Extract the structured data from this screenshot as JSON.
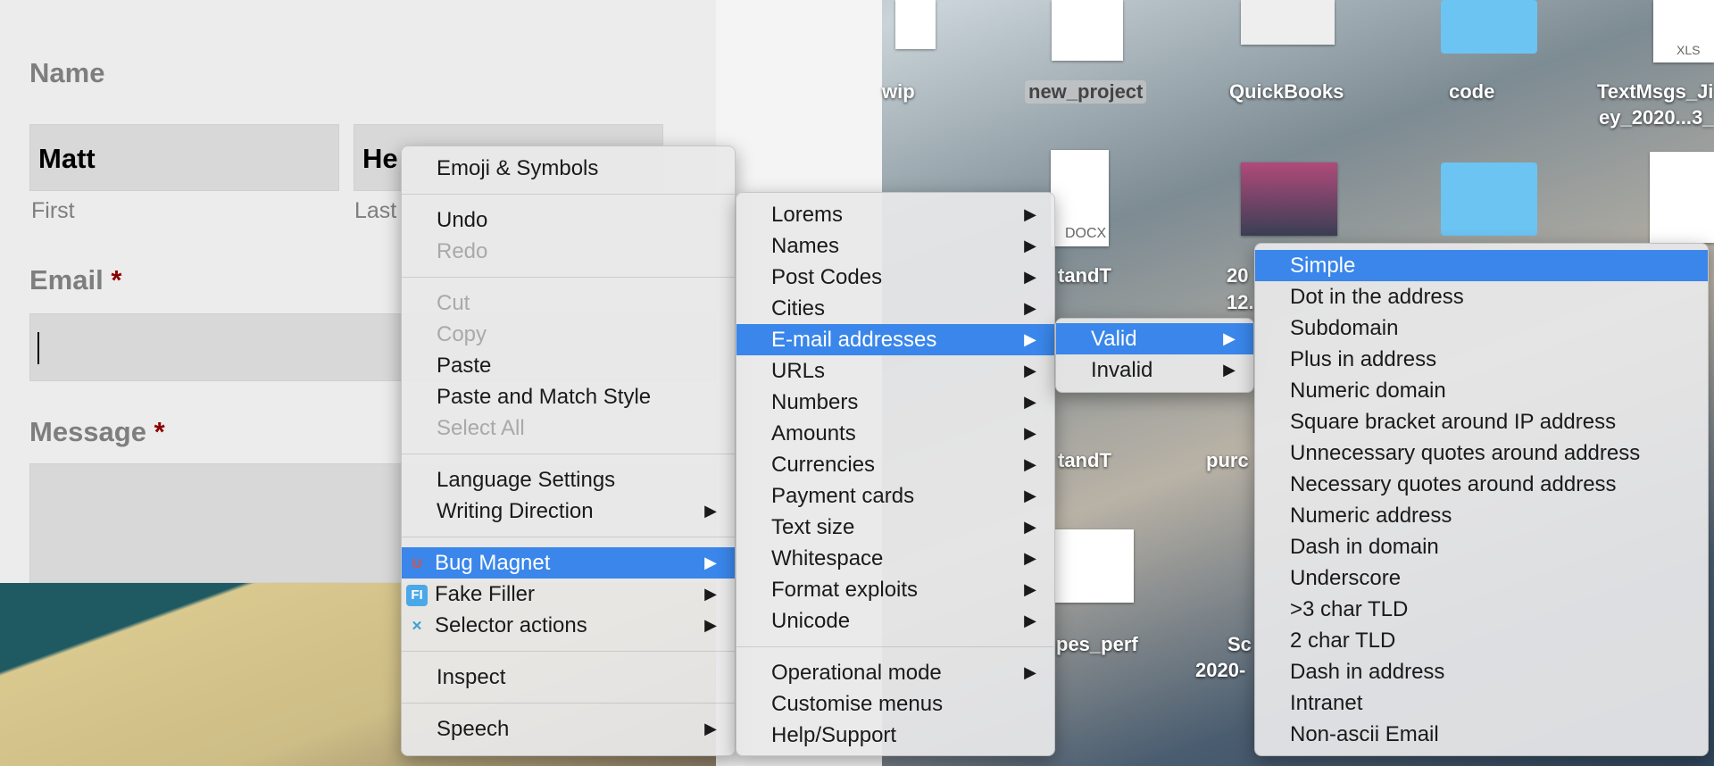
{
  "form": {
    "name_label": "Name",
    "first_value": "Matt",
    "last_value": "He",
    "first_sub": "First",
    "last_sub": "Last",
    "email_label": "Email",
    "message_label": "Message",
    "required_mark": "*"
  },
  "desktop": {
    "labels": [
      "wip",
      "new_project",
      "QuickBooks",
      "code",
      "TextMsgs_Ji",
      "ey_2020...3_",
      "tandT",
      "20",
      "12.",
      "tandT",
      "purc",
      "pes_perf",
      "Sc",
      "2020-",
      "DOCX",
      "XLS"
    ]
  },
  "context_menu": {
    "groups": [
      [
        {
          "label": "Emoji & Symbols"
        }
      ],
      [
        {
          "label": "Undo"
        },
        {
          "label": "Redo",
          "disabled": true
        }
      ],
      [
        {
          "label": "Cut",
          "disabled": true
        },
        {
          "label": "Copy",
          "disabled": true
        },
        {
          "label": "Paste"
        },
        {
          "label": "Paste and Match Style"
        },
        {
          "label": "Select All",
          "disabled": true
        }
      ],
      [
        {
          "label": "Language Settings"
        },
        {
          "label": "Writing Direction",
          "submenu": true
        }
      ],
      [
        {
          "label": "Bug Magnet",
          "submenu": true,
          "highlighted": true,
          "icon": "magnet-icon"
        },
        {
          "label": "Fake Filler",
          "submenu": true,
          "icon": "fake-filler-icon"
        },
        {
          "label": "Selector actions",
          "submenu": true,
          "icon": "selector-actions-icon"
        }
      ],
      [
        {
          "label": "Inspect"
        }
      ],
      [
        {
          "label": "Speech",
          "submenu": true
        }
      ]
    ]
  },
  "bug_magnet_menu": {
    "groups": [
      [
        {
          "label": "Lorems",
          "submenu": true
        },
        {
          "label": "Names",
          "submenu": true
        },
        {
          "label": "Post Codes",
          "submenu": true
        },
        {
          "label": "Cities",
          "submenu": true
        },
        {
          "label": "E-mail addresses",
          "submenu": true,
          "highlighted": true
        },
        {
          "label": "URLs",
          "submenu": true
        },
        {
          "label": "Numbers",
          "submenu": true
        },
        {
          "label": "Amounts",
          "submenu": true
        },
        {
          "label": "Currencies",
          "submenu": true
        },
        {
          "label": "Payment cards",
          "submenu": true
        },
        {
          "label": "Text size",
          "submenu": true
        },
        {
          "label": "Whitespace",
          "submenu": true
        },
        {
          "label": "Format exploits",
          "submenu": true
        },
        {
          "label": "Unicode",
          "submenu": true
        }
      ],
      [
        {
          "label": "Operational mode",
          "submenu": true
        },
        {
          "label": "Customise menus"
        },
        {
          "label": "Help/Support"
        }
      ]
    ]
  },
  "email_menu": {
    "groups": [
      [
        {
          "label": "Valid",
          "submenu": true,
          "highlighted": true
        },
        {
          "label": "Invalid",
          "submenu": true
        }
      ]
    ]
  },
  "valid_menu": {
    "groups": [
      [
        {
          "label": "Simple",
          "highlighted": true
        },
        {
          "label": "Dot in the address"
        },
        {
          "label": "Subdomain"
        },
        {
          "label": "Plus in address"
        },
        {
          "label": "Numeric domain"
        },
        {
          "label": "Square bracket around IP address"
        },
        {
          "label": "Unnecessary quotes around address"
        },
        {
          "label": "Necessary quotes around address"
        },
        {
          "label": "Numeric address"
        },
        {
          "label": "Dash in domain"
        },
        {
          "label": "Underscore"
        },
        {
          "label": ">3 char TLD"
        },
        {
          "label": "2 char TLD"
        },
        {
          "label": "Dash in address"
        },
        {
          "label": "Intranet"
        },
        {
          "label": "Non-ascii Email"
        }
      ]
    ]
  },
  "colors": {
    "highlight": "#3a86ea",
    "required": "#8b0000"
  },
  "arrow_glyph": "▶"
}
